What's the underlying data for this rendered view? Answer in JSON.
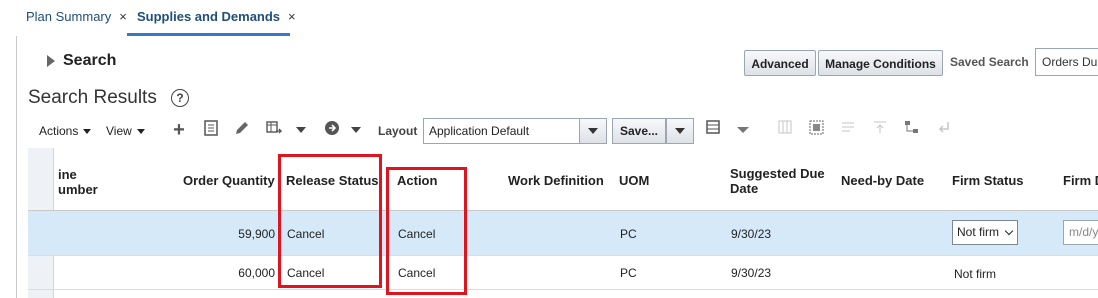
{
  "tabs": [
    {
      "label": "Plan Summary",
      "close": "×"
    },
    {
      "label": "Supplies and Demands",
      "close": "×"
    }
  ],
  "search": {
    "title": "Search",
    "advanced_label": "Advanced",
    "manage_conditions_label": "Manage Conditions",
    "saved_search_label": "Saved Search",
    "saved_search_value": "Orders Due"
  },
  "results": {
    "title": "Search Results",
    "help": "?"
  },
  "toolbar": {
    "actions_label": "Actions",
    "view_label": "View",
    "layout_label": "Layout",
    "layout_value": "Application Default",
    "save_label": "Save..."
  },
  "table": {
    "headers": {
      "line_number": [
        "ine",
        "umber"
      ],
      "order_quantity": "Order Quantity",
      "release_status": "Release Status",
      "action": "Action",
      "work_definition": "Work Definition",
      "uom": "UOM",
      "suggested_due_date": [
        "Suggested Due",
        "Date"
      ],
      "need_by_date": "Need-by Date",
      "firm_status": "Firm Status",
      "firm_date": "Firm D"
    },
    "rows": [
      {
        "order_quantity": "59,900",
        "release_status": "Cancel",
        "action": "Cancel",
        "uom": "PC",
        "suggested_due_date": "9/30/23",
        "firm_status": "Not firm",
        "firm_date_placeholder": "m/d/y"
      },
      {
        "order_quantity": "60,000",
        "release_status": "Cancel",
        "action": "Cancel",
        "uom": "PC",
        "suggested_due_date": "9/30/23",
        "firm_status": "Not firm"
      }
    ]
  },
  "colors": {
    "accent": "#3579c7",
    "highlight_box": "#e0141e",
    "selected_row": "#d6e9f8"
  }
}
